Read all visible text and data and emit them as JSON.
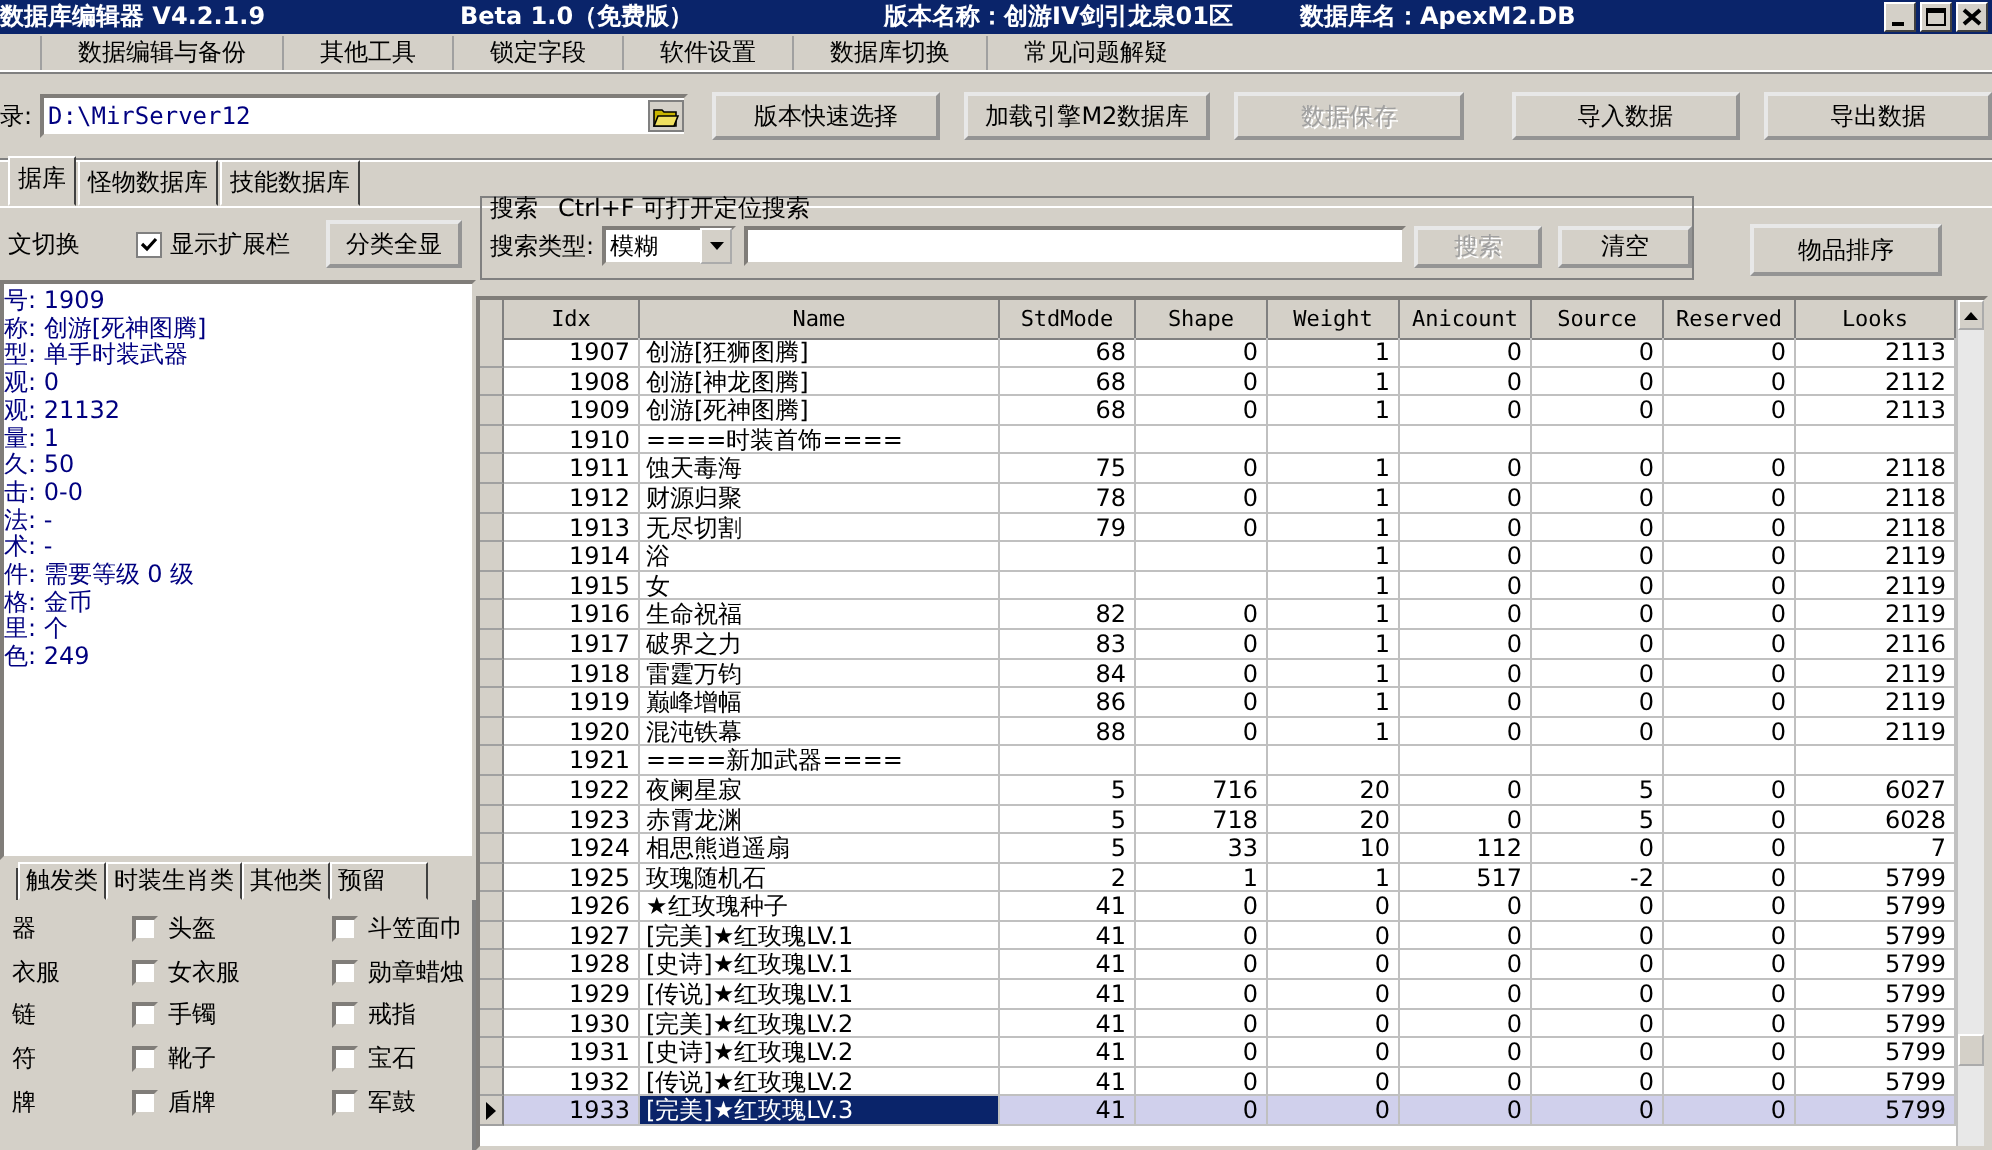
{
  "window": {
    "title": "数据库编辑器 V4.2.1.9",
    "edition": "Beta 1.0（免费版）",
    "version_name": "版本名称：创游IV剑引龙泉01区",
    "database_name": "数据库名：ApexM2.DB"
  },
  "menu": [
    "数据编辑与备份",
    "其他工具",
    "锁定字段",
    "软件设置",
    "数据库切换",
    "常见问题解疑"
  ],
  "toolbar": {
    "path_label": "录:",
    "path_value": "D:\\MirServer12",
    "buttons": [
      {
        "label": "版本快速选择",
        "disabled": false
      },
      {
        "label": "加载引擎M2数据库",
        "disabled": false
      },
      {
        "label": "数据保存",
        "disabled": true
      },
      {
        "label": "导入数据",
        "disabled": false
      },
      {
        "label": "导出数据",
        "disabled": false
      }
    ]
  },
  "tabs": [
    {
      "label": "据库",
      "selected": true
    },
    {
      "label": "怪物数据库",
      "selected": false
    },
    {
      "label": "技能数据库",
      "selected": false
    }
  ],
  "left_panel": {
    "switch_label": "文切换",
    "show_extension": {
      "label": "显示扩展栏",
      "checked": true
    },
    "show_all_button": "分类全显",
    "details": [
      "号: 1909",
      "称: 创游[死神图腾]",
      "型: 单手时装武器",
      "观: 0",
      "观: 21132",
      "量: 1",
      "久: 50",
      "击: 0-0",
      "法: -",
      "术: -",
      "件: 需要等级 0 级",
      "格: 金币",
      "里: 个",
      "色: 249"
    ],
    "category_tabs": [
      {
        "label": "触发类",
        "selected": false
      },
      {
        "label": "时装生肖类",
        "selected": false
      },
      {
        "label": "其他类",
        "selected": false
      },
      {
        "label": "预留",
        "selected": false
      }
    ],
    "categories": [
      {
        "kind": "fragment",
        "label": "器"
      },
      {
        "kind": "checkbox",
        "label": "头盔",
        "checked": false
      },
      {
        "kind": "checkbox",
        "label": "斗笠面巾",
        "checked": false
      },
      {
        "kind": "fragment",
        "label": "衣服"
      },
      {
        "kind": "checkbox",
        "label": "女衣服",
        "checked": false
      },
      {
        "kind": "checkbox",
        "label": "勋章蜡烛",
        "checked": false
      },
      {
        "kind": "fragment",
        "label": "链"
      },
      {
        "kind": "checkbox",
        "label": "手镯",
        "checked": false
      },
      {
        "kind": "checkbox",
        "label": "戒指",
        "checked": false
      },
      {
        "kind": "fragment",
        "label": "符"
      },
      {
        "kind": "checkbox",
        "label": "靴子",
        "checked": false
      },
      {
        "kind": "checkbox",
        "label": "宝石",
        "checked": false
      },
      {
        "kind": "fragment",
        "label": "牌"
      },
      {
        "kind": "checkbox",
        "label": "盾牌",
        "checked": false
      },
      {
        "kind": "checkbox",
        "label": "军鼓",
        "checked": false
      }
    ]
  },
  "search": {
    "title": "搜索",
    "hint": "Ctrl+F 可打开定位搜索",
    "type_label": "搜索类型:",
    "type_value": "模糊",
    "buttons": [
      {
        "label": "搜索",
        "disabled": true
      },
      {
        "label": "清空",
        "disabled": false
      }
    ],
    "sort_button": "物品排序"
  },
  "table": {
    "columns": [
      "Idx",
      "Name",
      "StdMode",
      "Shape",
      "Weight",
      "Anicount",
      "Source",
      "Reserved",
      "Looks"
    ],
    "rows": [
      {
        "kind": "item",
        "selected": false,
        "cells": [
          "1907",
          "创游[狂狮图腾]",
          "68",
          "0",
          "1",
          "0",
          "0",
          "0",
          "2113"
        ]
      },
      {
        "kind": "item",
        "selected": false,
        "cells": [
          "1908",
          "创游[神龙图腾]",
          "68",
          "0",
          "1",
          "0",
          "0",
          "0",
          "2112"
        ]
      },
      {
        "kind": "item",
        "selected": false,
        "cells": [
          "1909",
          "创游[死神图腾]",
          "68",
          "0",
          "1",
          "0",
          "0",
          "0",
          "2113"
        ]
      },
      {
        "kind": "separator",
        "selected": false,
        "cells": [
          "1910",
          "====时装首饰===="
        ]
      },
      {
        "kind": "item",
        "selected": false,
        "cells": [
          "1911",
          "蚀天毒海",
          "75",
          "0",
          "1",
          "0",
          "0",
          "0",
          "2118"
        ]
      },
      {
        "kind": "item",
        "selected": false,
        "cells": [
          "1912",
          "财源归聚",
          "78",
          "0",
          "1",
          "0",
          "0",
          "0",
          "2118"
        ]
      },
      {
        "kind": "item",
        "selected": false,
        "cells": [
          "1913",
          "无尽切割",
          "79",
          "0",
          "1",
          "0",
          "0",
          "0",
          "2118"
        ]
      },
      {
        "kind": "item",
        "selected": false,
        "cells": [
          "1914",
          "浴",
          "",
          "",
          "1",
          "0",
          "0",
          "0",
          "2119"
        ]
      },
      {
        "kind": "item",
        "selected": false,
        "cells": [
          "1915",
          "女",
          "",
          "",
          "1",
          "0",
          "0",
          "0",
          "2119"
        ]
      },
      {
        "kind": "item",
        "selected": false,
        "cells": [
          "1916",
          "生命祝福",
          "82",
          "0",
          "1",
          "0",
          "0",
          "0",
          "2119"
        ]
      },
      {
        "kind": "item",
        "selected": false,
        "cells": [
          "1917",
          "破界之力",
          "83",
          "0",
          "1",
          "0",
          "0",
          "0",
          "2116"
        ]
      },
      {
        "kind": "item",
        "selected": false,
        "cells": [
          "1918",
          "雷霆万钧",
          "84",
          "0",
          "1",
          "0",
          "0",
          "0",
          "2119"
        ]
      },
      {
        "kind": "item",
        "selected": false,
        "cells": [
          "1919",
          "巅峰增幅",
          "86",
          "0",
          "1",
          "0",
          "0",
          "0",
          "2119"
        ]
      },
      {
        "kind": "item",
        "selected": false,
        "cells": [
          "1920",
          "混沌铁幕",
          "88",
          "0",
          "1",
          "0",
          "0",
          "0",
          "2119"
        ]
      },
      {
        "kind": "separator",
        "selected": false,
        "cells": [
          "1921",
          "====新加武器===="
        ]
      },
      {
        "kind": "item",
        "selected": false,
        "cells": [
          "1922",
          "夜阑星寂",
          "5",
          "716",
          "20",
          "0",
          "5",
          "0",
          "6027"
        ]
      },
      {
        "kind": "item",
        "selected": false,
        "cells": [
          "1923",
          "赤霄龙渊",
          "5",
          "718",
          "20",
          "0",
          "5",
          "0",
          "6028"
        ]
      },
      {
        "kind": "item",
        "selected": false,
        "cells": [
          "1924",
          "相思熊逍遥扇",
          "5",
          "33",
          "10",
          "112",
          "0",
          "0",
          "7"
        ]
      },
      {
        "kind": "item",
        "selected": false,
        "cells": [
          "1925",
          "玫瑰随机石",
          "2",
          "1",
          "1",
          "517",
          "-2",
          "0",
          "5799"
        ]
      },
      {
        "kind": "item",
        "selected": false,
        "cells": [
          "1926",
          "★红玫瑰种子",
          "41",
          "0",
          "0",
          "0",
          "0",
          "0",
          "5799"
        ]
      },
      {
        "kind": "item",
        "selected": false,
        "cells": [
          "1927",
          "[完美]★红玫瑰LV.1",
          "41",
          "0",
          "0",
          "0",
          "0",
          "0",
          "5799"
        ]
      },
      {
        "kind": "item",
        "selected": false,
        "cells": [
          "1928",
          "[史诗]★红玫瑰LV.1",
          "41",
          "0",
          "0",
          "0",
          "0",
          "0",
          "5799"
        ]
      },
      {
        "kind": "item",
        "selected": false,
        "cells": [
          "1929",
          "[传说]★红玫瑰LV.1",
          "41",
          "0",
          "0",
          "0",
          "0",
          "0",
          "5799"
        ]
      },
      {
        "kind": "item",
        "selected": false,
        "cells": [
          "1930",
          "[完美]★红玫瑰LV.2",
          "41",
          "0",
          "0",
          "0",
          "0",
          "0",
          "5799"
        ]
      },
      {
        "kind": "item",
        "selected": false,
        "cells": [
          "1931",
          "[史诗]★红玫瑰LV.2",
          "41",
          "0",
          "0",
          "0",
          "0",
          "0",
          "5799"
        ]
      },
      {
        "kind": "item",
        "selected": false,
        "cells": [
          "1932",
          "[传说]★红玫瑰LV.2",
          "41",
          "0",
          "0",
          "0",
          "0",
          "0",
          "5799"
        ]
      },
      {
        "kind": "item",
        "selected": true,
        "cells": [
          "1933",
          "[完美]★红玫瑰LV.3",
          "41",
          "0",
          "0",
          "0",
          "0",
          "0",
          "5799"
        ]
      }
    ]
  }
}
